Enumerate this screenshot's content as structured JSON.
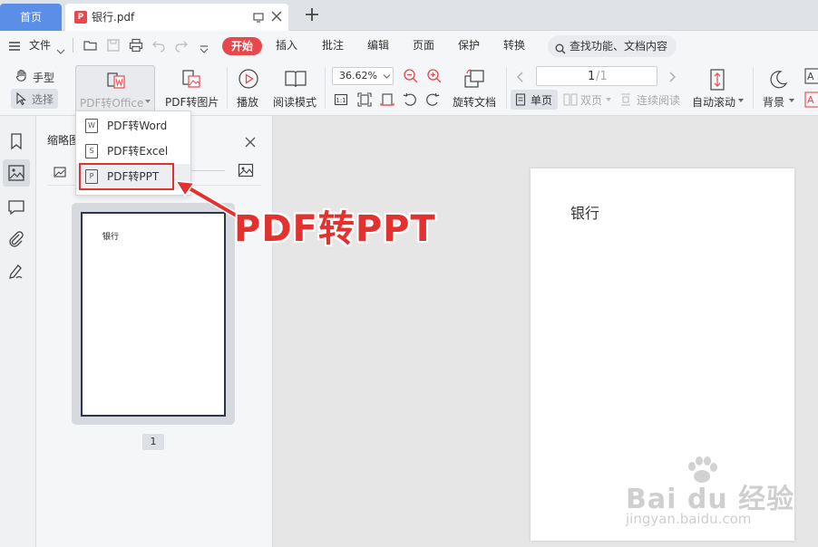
{
  "tabs": {
    "home": "首页",
    "document": "银行.pdf",
    "pdf_badge": "P"
  },
  "menu": {
    "file": "文件",
    "items": [
      "开始",
      "插入",
      "批注",
      "编辑",
      "页面",
      "保护",
      "转换"
    ],
    "search_placeholder": "查找功能、文档内容"
  },
  "toolbar": {
    "hand": "手型",
    "select": "选择",
    "pdf_to_office": "PDF转Office",
    "pdf_to_image": "PDF转图片",
    "play": "播放",
    "read_mode": "阅读模式",
    "zoom": "36.62%",
    "rotate_doc": "旋转文档",
    "page_input": "1",
    "page_total": "/1",
    "single_page": "单页",
    "double_page": "双页",
    "continuous": "连续阅读",
    "auto_scroll": "自动滚动",
    "background": "背景"
  },
  "dropdown": {
    "items": [
      "PDF转Word",
      "PDF转Excel",
      "PDF转PPT"
    ]
  },
  "thumbnail_panel": {
    "title": "缩略图",
    "page_number": "1",
    "thumb_text": "银行"
  },
  "document_page": {
    "text": "银行"
  },
  "annotation": {
    "text": "PDF转PPT"
  },
  "watermark": {
    "brand": "Bai du 经验",
    "url": "jingyan.baidu.com"
  },
  "colors": {
    "accent_red": "#e5484d",
    "tab_blue": "#5b8ee6",
    "annotation_red": "#e2322f"
  }
}
